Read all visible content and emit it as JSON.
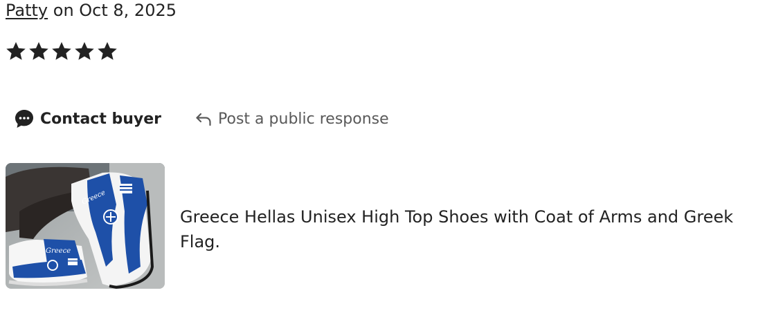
{
  "review": {
    "reviewer": "Patty",
    "date_text": " on Oct 8, 2025",
    "rating": 5,
    "rating_max": 5
  },
  "actions": {
    "contact_label": "Contact buyer",
    "respond_label": "Post a public response"
  },
  "listing": {
    "title": "Greece Hellas Unisex High Top Shoes with Coat of Arms and Greek Flag.",
    "thumbnail_text": "Greece"
  },
  "colors": {
    "text": "#222222",
    "muted": "#595959",
    "star": "#222222",
    "shoe_blue": "#1e50a8"
  },
  "icons": {
    "star": "star-icon",
    "contact": "chat-bubble-icon",
    "respond": "reply-arrow-icon"
  }
}
